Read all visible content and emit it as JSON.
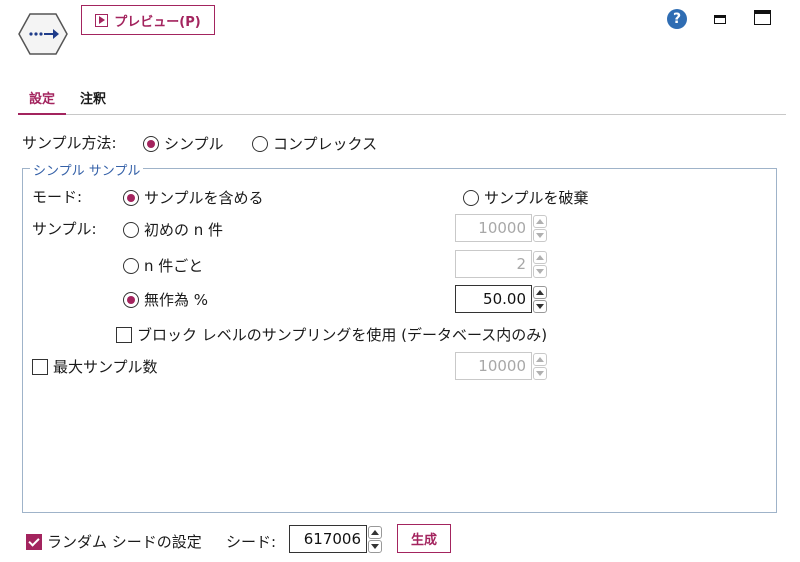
{
  "header": {
    "node_icon": "sample-node-icon",
    "preview_icon": "play-icon",
    "preview_label": "プレビュー(P)",
    "help_icon": "question-icon",
    "help_glyph": "?",
    "minimize_icon": "minimize-icon",
    "maximize_icon": "maximize-icon"
  },
  "tabs": [
    {
      "label": "設定",
      "active": true
    },
    {
      "label": "注釈",
      "active": false
    }
  ],
  "sample_method": {
    "label": "サンプル方法:",
    "options": [
      {
        "label": "シンプル",
        "selected": true
      },
      {
        "label": "コンプレックス",
        "selected": false
      }
    ]
  },
  "simple_group": {
    "title": "シンプル サンプル",
    "mode": {
      "label": "モード:",
      "options": [
        {
          "label": "サンプルを含める",
          "selected": true
        },
        {
          "label": "サンプルを破棄",
          "selected": false
        }
      ]
    },
    "sample": {
      "label": "サンプル:",
      "options": [
        {
          "label": "初めの n 件",
          "selected": false,
          "value": "10000",
          "enabled": false
        },
        {
          "label": "n 件ごと",
          "selected": false,
          "value": "2",
          "enabled": false
        },
        {
          "label": "無作為 %",
          "selected": true,
          "value": "50.00",
          "enabled": true
        }
      ]
    },
    "block_level": {
      "label": "ブロック レベルのサンプリングを使用 (データベース内のみ)",
      "checked": false
    },
    "max_samples": {
      "label": "最大サンプル数",
      "checked": false,
      "value": "10000",
      "enabled": false
    }
  },
  "footer": {
    "random_seed": {
      "label": "ランダム シードの設定",
      "checked": true
    },
    "seed_label": "シード:",
    "seed_value": "617006",
    "generate_label": "生成"
  },
  "colors": {
    "accent": "#a3245e",
    "group_border": "#9fb3c9",
    "group_title": "#3561a8",
    "help_blue": "#2f6db3"
  }
}
